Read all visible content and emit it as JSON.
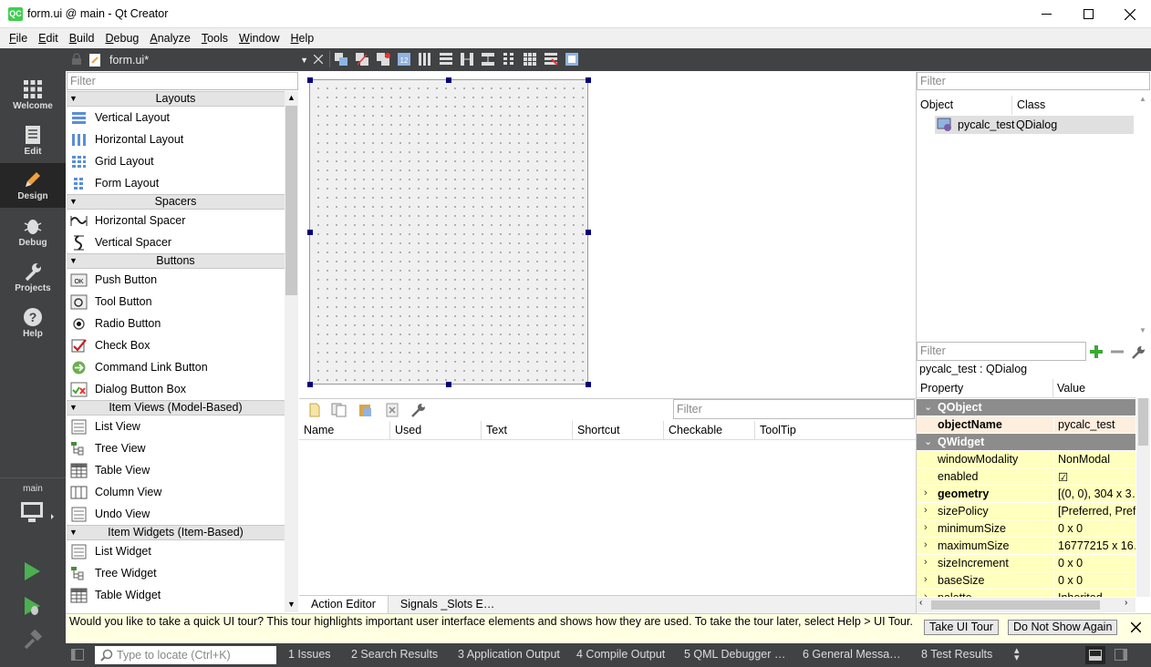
{
  "window": {
    "title": "form.ui @ main - Qt Creator",
    "app_icon": "QC"
  },
  "menu": [
    "File",
    "Edit",
    "Build",
    "Debug",
    "Analyze",
    "Tools",
    "Window",
    "Help"
  ],
  "modes": [
    {
      "label": "Welcome",
      "icon": "grid-icon"
    },
    {
      "label": "Edit",
      "icon": "document-icon"
    },
    {
      "label": "Design",
      "icon": "pencil-icon",
      "active": true
    },
    {
      "label": "Debug",
      "icon": "bug-icon"
    },
    {
      "label": "Projects",
      "icon": "wrench-icon"
    },
    {
      "label": "Help",
      "icon": "help-icon"
    }
  ],
  "kit": {
    "label": "main"
  },
  "editor": {
    "file_name": "form.ui*"
  },
  "widget_box": {
    "filter_placeholder": "Filter",
    "categories": [
      {
        "name": "Layouts",
        "items": [
          "Vertical Layout",
          "Horizontal Layout",
          "Grid Layout",
          "Form Layout"
        ]
      },
      {
        "name": "Spacers",
        "items": [
          "Horizontal Spacer",
          "Vertical Spacer"
        ]
      },
      {
        "name": "Buttons",
        "items": [
          "Push Button",
          "Tool Button",
          "Radio Button",
          "Check Box",
          "Command Link Button",
          "Dialog Button Box"
        ]
      },
      {
        "name": "Item Views (Model-Based)",
        "items": [
          "List View",
          "Tree View",
          "Table View",
          "Column View",
          "Undo View"
        ]
      },
      {
        "name": "Item Widgets (Item-Based)",
        "items": [
          "List Widget",
          "Tree Widget",
          "Table Widget"
        ]
      }
    ]
  },
  "action_editor": {
    "filter_placeholder": "Filter",
    "columns": [
      "Name",
      "Used",
      "Text",
      "Shortcut",
      "Checkable",
      "ToolTip"
    ],
    "tabs": [
      "Action Editor",
      "Signals _Slots E…"
    ]
  },
  "object_inspector": {
    "filter_placeholder": "Filter",
    "columns": [
      "Object",
      "Class"
    ],
    "rows": [
      {
        "object": "pycalc_test",
        "class": "QDialog"
      }
    ]
  },
  "property_editor": {
    "filter_placeholder": "Filter",
    "object_label": "pycalc_test : QDialog",
    "columns": [
      "Property",
      "Value"
    ],
    "rows": [
      {
        "type": "group",
        "name": "QObject"
      },
      {
        "type": "prop",
        "name": "objectName",
        "value": "pycalc_test",
        "bold": true,
        "style": "or"
      },
      {
        "type": "group",
        "name": "QWidget"
      },
      {
        "type": "prop",
        "name": "windowModality",
        "value": "NonModal",
        "style": "yel"
      },
      {
        "type": "prop",
        "name": "enabled",
        "value": "☑",
        "style": "yel"
      },
      {
        "type": "prop",
        "name": "geometry",
        "value": "[(0, 0), 304 x 3…",
        "bold": true,
        "expand": true,
        "style": "yel"
      },
      {
        "type": "prop",
        "name": "sizePolicy",
        "value": "[Preferred, Pref…",
        "expand": true,
        "style": "yel"
      },
      {
        "type": "prop",
        "name": "minimumSize",
        "value": "0 x 0",
        "expand": true,
        "style": "yel"
      },
      {
        "type": "prop",
        "name": "maximumSize",
        "value": "16777215 x 16…",
        "expand": true,
        "style": "yel"
      },
      {
        "type": "prop",
        "name": "sizeIncrement",
        "value": "0 x 0",
        "expand": true,
        "style": "yel"
      },
      {
        "type": "prop",
        "name": "baseSize",
        "value": "0 x 0",
        "expand": true,
        "style": "yel"
      },
      {
        "type": "prop",
        "name": "palette",
        "value": "Inherited",
        "expand": true,
        "style": "yel"
      }
    ]
  },
  "tour": {
    "message": "Would you like to take a quick UI tour? This tour highlights important user interface elements and shows how they are used. To take the tour later, select Help > UI Tour.",
    "take_label": "Take UI Tour",
    "dismiss_label": "Do Not Show Again"
  },
  "status_bar": {
    "locator_placeholder": "Type to locate (Ctrl+K)",
    "panes": [
      "1  Issues",
      "2  Search Results",
      "3  Application Output",
      "4  Compile Output",
      "5  QML Debugger …",
      "6  General Messa…",
      "8  Test Results"
    ]
  },
  "colors": {
    "dark_bar": "#404244",
    "accent_green": "#41cd52",
    "handle": "#000080"
  }
}
